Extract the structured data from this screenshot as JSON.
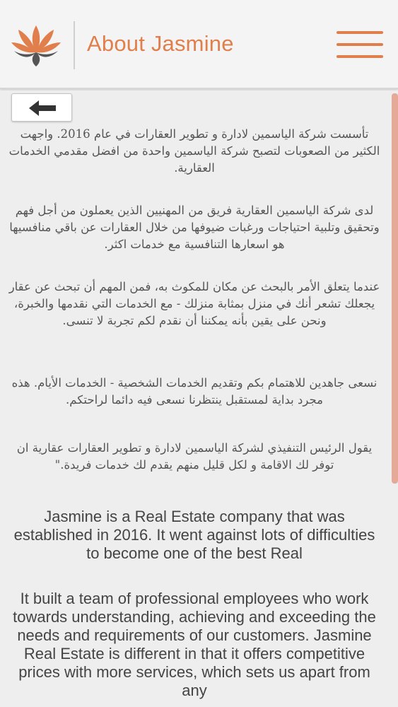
{
  "header": {
    "title": "About Jasmine",
    "logo_icon": "lotus-logo-icon",
    "menu_icon": "hamburger-menu-icon",
    "accent_color": "#e07f4c"
  },
  "content": {
    "back_icon": "arrow-left-icon",
    "arabic_paragraphs": [
      "تأسست شركة الياسمين لادارة و تطوير العقارات في عام 2016. واجهت الكثير من الصعوبات لتصبح شركة الياسمين واحدة من افضل مقدمي الخدمات العقارية.",
      "لدى شركة الياسمين العقارية فريق من المهنيين الذين يعملون من أجل فهم وتحقيق وتلبية احتياجات ورغبات ضيوفها من خلال العقارات عن باقي منافسيها هو اسعارها التنافسية مع خدمات اكثر.",
      "عندما يتعلق الأمر بالبحث عن مكان للمكوث به، فمن المهم أن تبحث عن عقار يجعلك تشعر أنك في منزل بمثابة منزلك - مع الخدمات التي نقدمها والخبرة، ونحن على يقين بأنه يمكننا أن نقدم لكم تجربة لا تنسى.",
      "نسعى جاهدين للاهتمام بكم وتقديم الخدمات الشخصية - الخدمات الأيام. هذه مجرد بداية لمستقبل ينتظرنا نسعى فيه دائما لراحتكم.",
      "يقول الرئيس التنفيذي لشركة الياسمين لادارة و تطوير العقارات عقارية ان توفر لك الاقامة و لكل قليل منهم يقدم لك خدمات فريدة.\""
    ],
    "english_paragraphs": [
      "Jasmine is a Real Estate company that was established in 2016. It went against lots of difficulties to become one of the best Real",
      "It built a team of professional employees who work towards understanding, achieving and exceeding the needs and requirements of our customers. Jasmine Real Estate is different in that it offers competitive prices with more services, which sets us apart from any"
    ]
  }
}
